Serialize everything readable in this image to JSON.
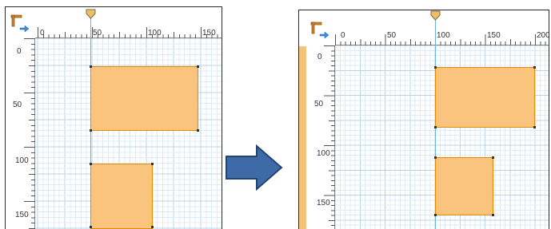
{
  "colors": {
    "grid_minor": "#dcebf7",
    "grid_major": "#b9d4ea",
    "shape_fill": "#fbc47e",
    "shape_border": "#e58a00",
    "guide": "#6ab0dc",
    "arrow_fill": "#3f6aa8",
    "arrow_stroke": "#22446f"
  },
  "icons": {
    "ruler_origin": "ruler-corner-icon",
    "guide_marker": "guide-marker-icon",
    "transition": "right-arrow-icon"
  },
  "left": {
    "h_labels": [
      "0",
      "50",
      "100",
      "150"
    ],
    "v_labels": [
      "0",
      "50",
      "100",
      "150"
    ]
  },
  "right": {
    "h_labels": [
      "0",
      "50",
      "100",
      "150",
      "200"
    ],
    "v_labels": [
      "0",
      "50",
      "100",
      "150"
    ]
  }
}
